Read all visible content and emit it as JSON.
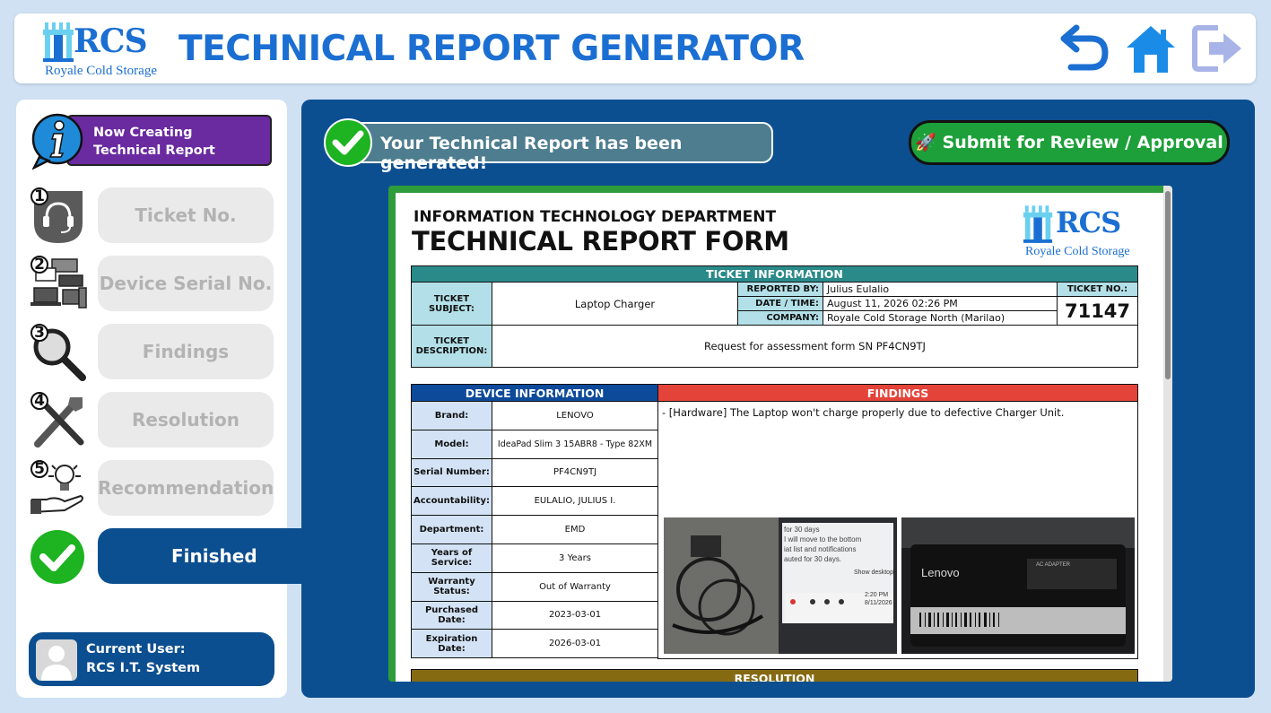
{
  "header": {
    "logo_text": "RCS",
    "logo_subtitle": "Royale Cold Storage",
    "title": "TECHNICAL REPORT GENERATOR",
    "icons": [
      "undo-icon",
      "home-icon",
      "logout-icon"
    ]
  },
  "sidebar": {
    "status_line1": "Now Creating",
    "status_line2": "Technical Report",
    "steps": [
      {
        "num": "1",
        "label": "Ticket No.",
        "icon": "headset-icon"
      },
      {
        "num": "2",
        "label": "Device Serial No.",
        "icon": "devices-icon"
      },
      {
        "num": "3",
        "label": "Findings",
        "icon": "magnifier-icon"
      },
      {
        "num": "4",
        "label": "Resolution",
        "icon": "tools-icon"
      },
      {
        "num": "5",
        "label": "Recommendation",
        "icon": "lightbulb-hand-icon"
      }
    ],
    "finished_label": "Finished",
    "user_label": "Current User:",
    "user_name": "RCS I.T. System"
  },
  "main": {
    "banner": "Your Technical Report has been generated!",
    "submit": "🚀 Submit for Review / Approval",
    "colors": {
      "accent": "#0c4f90",
      "success": "#1da03a",
      "status": "#6a2aa0"
    }
  },
  "report": {
    "dept": "INFORMATION TECHNOLOGY DEPARTMENT",
    "title": "TECHNICAL REPORT FORM",
    "logo_text": "RCS",
    "logo_subtitle": "Royale Cold Storage",
    "ticket_section": "TICKET INFORMATION",
    "ticket_subject_label": "TICKET SUBJECT:",
    "ticket_subject": "Laptop Charger",
    "reported_by_label": "REPORTED BY:",
    "reported_by": "Julius Eulalio",
    "datetime_label": "DATE / TIME:",
    "datetime": "August 11, 2026 02:26 PM",
    "company_label": "COMPANY:",
    "company": "Royale Cold Storage North (Marilao)",
    "ticket_no_label": "TICKET NO.:",
    "ticket_no": "71147",
    "ticket_desc_label": "TICKET DESCRIPTION:",
    "ticket_desc": "Request for assessment form SN PF4CN9TJ",
    "device_section": "DEVICE INFORMATION",
    "device_rows": [
      {
        "label": "Brand:",
        "value": "LENOVO"
      },
      {
        "label": "Model:",
        "value": "IdeaPad Slim 3 15ABR8 - Type 82XM"
      },
      {
        "label": "Serial Number:",
        "value": "PF4CN9TJ"
      },
      {
        "label": "Accountability:",
        "value": "EULALIO, JULIUS I."
      },
      {
        "label": "Department:",
        "value": "EMD"
      },
      {
        "label": "Years of Service:",
        "value": "3 Years"
      },
      {
        "label": "Warranty Status:",
        "value": "Out of Warranty"
      },
      {
        "label": "Purchased Date:",
        "value": "2023-03-01"
      },
      {
        "label": "Expiration Date:",
        "value": "2026-03-01"
      }
    ],
    "findings_section": "FINDINGS",
    "findings_text": "- [Hardware]  The Laptop won't charge properly due to defective Charger Unit.",
    "photo1_text": [
      "for 30 days",
      "I will move to the bottom",
      "iat list and notifications",
      "auted for 30 days.",
      "Show desktop",
      "2:20 PM",
      "8/11/2026"
    ],
    "photo2_text": [
      "Lenovo",
      "AC ADAPTER"
    ],
    "resolution_section": "RESOLUTION"
  }
}
